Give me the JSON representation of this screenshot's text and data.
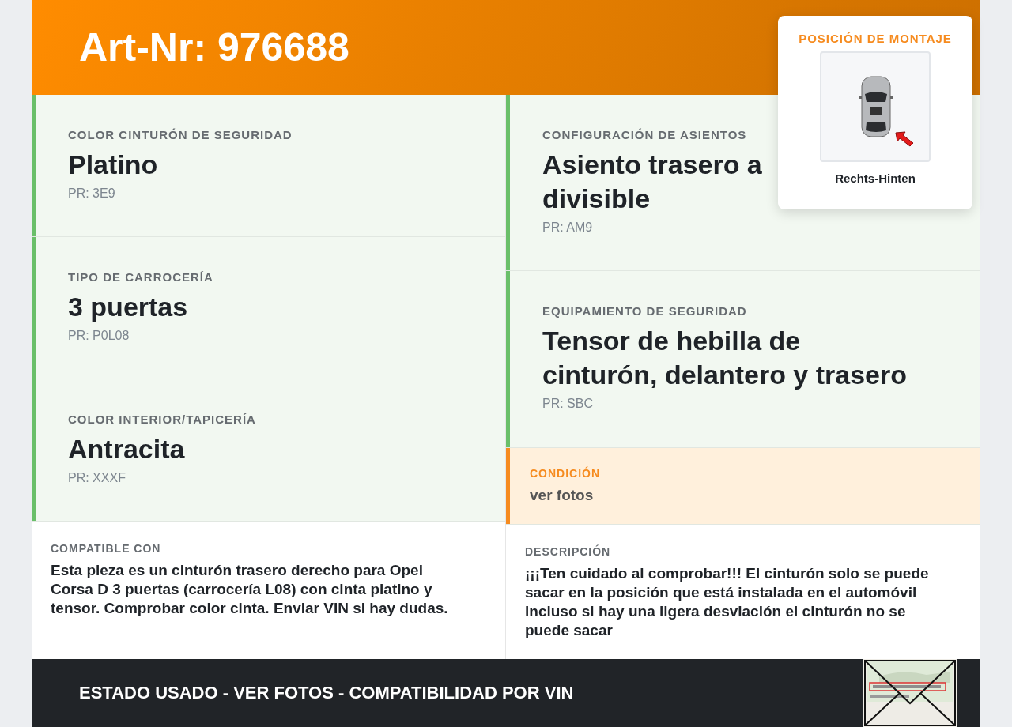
{
  "header": {
    "title": "Art-Nr: 976688"
  },
  "mounting": {
    "title": "POSICIÓN DE MONTAJE",
    "position": "Rechts-Hinten"
  },
  "left_specs": [
    {
      "label": "COLOR CINTURÓN DE SEGURIDAD",
      "value": "Platino",
      "code": "PR: 3E9"
    },
    {
      "label": "TIPO DE CARROCERÍA",
      "value": "3 puertas",
      "code": "PR: P0L08"
    },
    {
      "label": "COLOR INTERIOR/TAPICERÍA",
      "value": "Antracita",
      "code": "PR: XXXF"
    }
  ],
  "right_specs": [
    {
      "label": "CONFIGURACIÓN DE ASIENTOS",
      "value": "Asiento trasero a divisible",
      "code": "PR: AM9"
    },
    {
      "label": "EQUIPAMIENTO DE SEGURIDAD",
      "value": "Tensor de hebilla de cinturón, delantero y trasero",
      "code": "PR: SBC"
    }
  ],
  "condition": {
    "label": "CONDICIÓN",
    "value": "ver fotos"
  },
  "compatible": {
    "label": "COMPATIBLE CON",
    "text": "Esta pieza es un cinturón trasero derecho para Opel Corsa D 3 puertas (carrocería L08) con cinta platino y tensor. Comprobar color cinta. Enviar VIN si hay dudas."
  },
  "description": {
    "label": "DESCRIPCIÓN",
    "text": "¡¡¡Ten cuidado al comprobar!!! El cinturón solo se puede sacar en la posición que está instalada en el automóvil incluso si hay una ligera desviación el cinturón no se puede sacar"
  },
  "footer": {
    "text": "ESTADO USADO - VER FOTOS - COMPATIBILIDAD POR VIN"
  }
}
